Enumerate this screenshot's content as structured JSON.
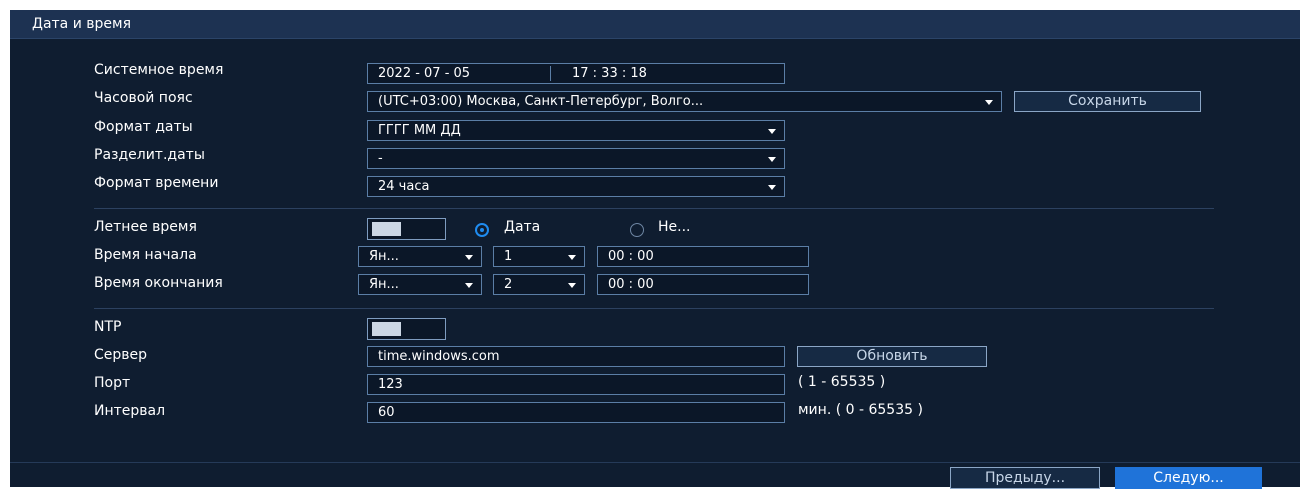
{
  "window": {
    "title": "Дата и время"
  },
  "labels": {
    "system_time": "Системное время",
    "timezone": "Часовой пояс",
    "date_format": "Формат даты",
    "date_separator": "Разделит.даты",
    "time_format": "Формат времени",
    "dst": "Летнее время",
    "start_time": "Время начала",
    "end_time": "Время окончания",
    "ntp": "NTP",
    "server": "Сервер",
    "port": "Порт",
    "interval": "Интервал"
  },
  "system_time": {
    "date": "2022  - 07 - 05",
    "time": "17 : 33 : 18"
  },
  "timezone": {
    "value": "(UTC+03:00) Москва, Санкт-Петербург, Волго...",
    "save_label": "Сохранить"
  },
  "date_format": {
    "value": "ГГГГ ММ ДД"
  },
  "date_separator": {
    "value": "-"
  },
  "time_format": {
    "value": "24 часа"
  },
  "dst": {
    "enabled": false,
    "mode_options": [
      "Дата",
      "Не..."
    ],
    "mode_selected": "Дата",
    "start": {
      "month": "Ян...",
      "week": "1",
      "time": "00 : 00"
    },
    "end": {
      "month": "Ян...",
      "week": "2",
      "time": "00 : 00"
    }
  },
  "ntp": {
    "enabled": false,
    "server": "time.windows.com",
    "update_label": "Обновить",
    "port": "123",
    "port_range": "( 1 - 65535 )",
    "interval": "60",
    "interval_hint": "мин.  ( 0 - 65535 )"
  },
  "footer": {
    "prev_label": "Предыду...",
    "next_label": "Следую..."
  },
  "colors": {
    "background": "#0f1d30",
    "titlebar": "#1d3252",
    "accent": "#1f73d9",
    "field_border": "#5b7ea6"
  }
}
